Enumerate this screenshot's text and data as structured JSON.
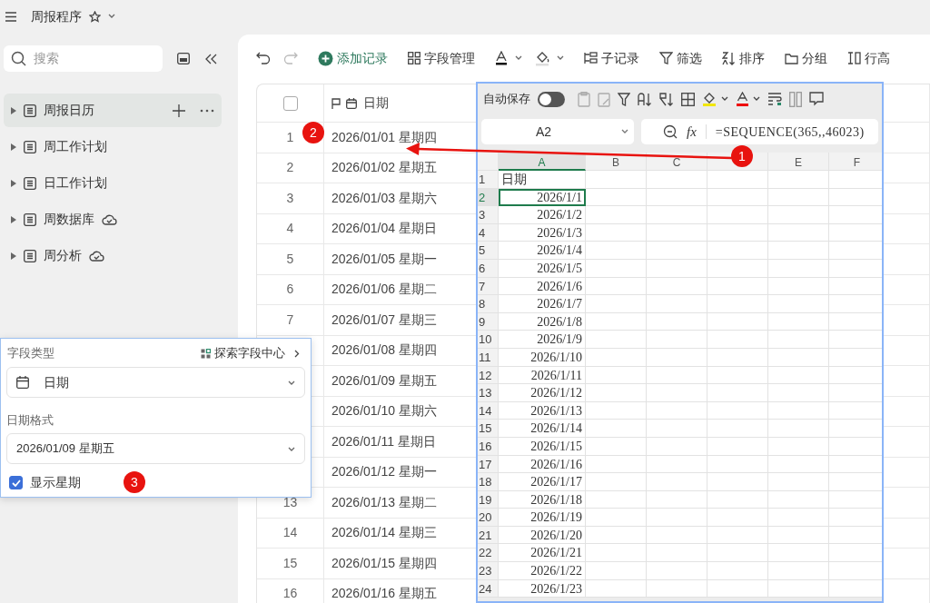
{
  "app": {
    "title": "周报程序"
  },
  "sidebar": {
    "search_placeholder": "搜索",
    "items": [
      {
        "label": "周报日历",
        "selected": true,
        "synced": false
      },
      {
        "label": "周工作计划",
        "selected": false,
        "synced": false
      },
      {
        "label": "日工作计划",
        "selected": false,
        "synced": false
      },
      {
        "label": "周数据库",
        "selected": false,
        "synced": true
      },
      {
        "label": "周分析",
        "selected": false,
        "synced": true
      }
    ]
  },
  "toolbar": [
    "添加记录",
    "字段管理",
    "子记录",
    "筛选",
    "排序",
    "分组",
    "行高"
  ],
  "table": {
    "all_selected": false,
    "columns": [
      {
        "label": "日期"
      }
    ],
    "rows": [
      {
        "number": "1",
        "date": "2026/01/01 星期四"
      },
      {
        "number": "2",
        "date": "2026/01/02 星期五"
      },
      {
        "number": "3",
        "date": "2026/01/03 星期六"
      },
      {
        "number": "4",
        "date": "2026/01/04 星期日"
      },
      {
        "number": "5",
        "date": "2026/01/05 星期一"
      },
      {
        "number": "6",
        "date": "2026/01/06 星期二"
      },
      {
        "number": "7",
        "date": "2026/01/07 星期三"
      },
      {
        "date": "2026/01/08 星期四"
      },
      {
        "date": "2026/01/09 星期五"
      },
      {
        "date": "2026/01/10 星期六"
      },
      {
        "date": "2026/01/11 星期日"
      },
      {
        "date": "2026/01/12 星期一"
      },
      {
        "number": "13",
        "date": "2026/01/13 星期二"
      },
      {
        "number": "14",
        "date": "2026/01/14 星期三"
      },
      {
        "number": "15",
        "date": "2026/01/15 星期四"
      },
      {
        "number": "16",
        "date": "2026/01/16 星期五"
      }
    ]
  },
  "sheet": {
    "autosave": {
      "label": "自动保存",
      "on": false
    },
    "name_box": "A2",
    "fx": "fx",
    "formula": "=SEQUENCE(365,,46023)",
    "columns": [
      {
        "label": "A",
        "selected": true
      },
      {
        "label": "B",
        "selected": false
      },
      {
        "label": "C",
        "selected": false
      },
      {
        "selected": false
      },
      {
        "label": "E",
        "selected": false
      },
      {
        "label": "F",
        "selected": false
      }
    ],
    "rows": [
      {
        "number": "1",
        "a": "日期",
        "kind": "text",
        "selected": false
      },
      {
        "number": "2",
        "a": "2026/1/1",
        "kind": "date",
        "selected": true
      },
      {
        "number": "3",
        "a": "2026/1/2",
        "kind": "date",
        "selected": false
      },
      {
        "number": "4",
        "a": "2026/1/3",
        "kind": "date",
        "selected": false
      },
      {
        "number": "5",
        "a": "2026/1/4",
        "kind": "date",
        "selected": false
      },
      {
        "number": "6",
        "a": "2026/1/5",
        "kind": "date",
        "selected": false
      },
      {
        "number": "7",
        "a": "2026/1/6",
        "kind": "date",
        "selected": false
      },
      {
        "number": "8",
        "a": "2026/1/7",
        "kind": "date",
        "selected": false
      },
      {
        "number": "9",
        "a": "2026/1/8",
        "kind": "date",
        "selected": false
      },
      {
        "number": "10",
        "a": "2026/1/9",
        "kind": "date",
        "selected": false
      },
      {
        "number": "11",
        "a": "2026/1/10",
        "kind": "date",
        "selected": false
      },
      {
        "number": "12",
        "a": "2026/1/11",
        "kind": "date",
        "selected": false
      },
      {
        "number": "13",
        "a": "2026/1/12",
        "kind": "date",
        "selected": false
      },
      {
        "number": "14",
        "a": "2026/1/13",
        "kind": "date",
        "selected": false
      },
      {
        "number": "15",
        "a": "2026/1/14",
        "kind": "date",
        "selected": false
      },
      {
        "number": "16",
        "a": "2026/1/15",
        "kind": "date",
        "selected": false
      },
      {
        "number": "17",
        "a": "2026/1/16",
        "kind": "date",
        "selected": false
      },
      {
        "number": "18",
        "a": "2026/1/17",
        "kind": "date",
        "selected": false
      },
      {
        "number": "19",
        "a": "2026/1/18",
        "kind": "date",
        "selected": false
      },
      {
        "number": "20",
        "a": "2026/1/19",
        "kind": "date",
        "selected": false
      },
      {
        "number": "21",
        "a": "2026/1/20",
        "kind": "date",
        "selected": false
      },
      {
        "number": "22",
        "a": "2026/1/21",
        "kind": "date",
        "selected": false
      },
      {
        "number": "23",
        "a": "2026/1/22",
        "kind": "date",
        "selected": false
      },
      {
        "number": "24",
        "a": "2026/1/23",
        "kind": "date",
        "selected": false
      }
    ]
  },
  "field_panel": {
    "type_label": "字段类型",
    "explore_link": "探索字段中心",
    "type_value": "日期",
    "format_label": "日期格式",
    "format_value": "2026/01/09 星期五",
    "show_weekday": {
      "label": "显示星期",
      "checked": true
    }
  },
  "annotations": [
    {
      "number": "1"
    },
    {
      "number": "2"
    },
    {
      "number": "3"
    }
  ]
}
